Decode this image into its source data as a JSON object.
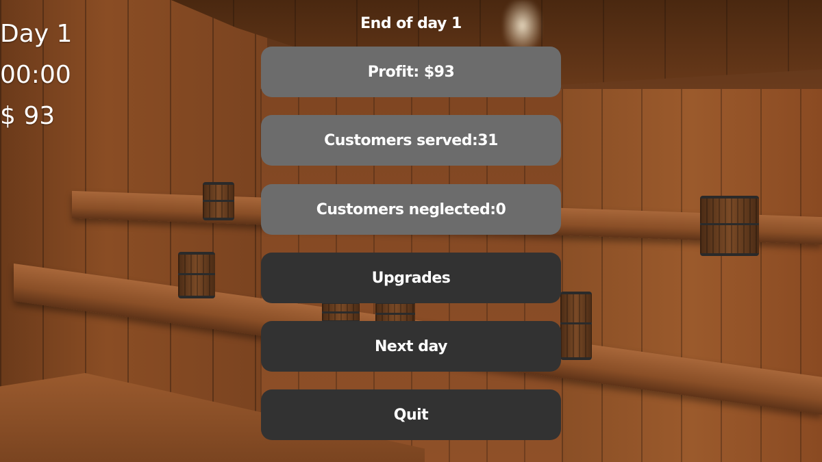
{
  "hud": {
    "day": "Day 1",
    "time": "00:00",
    "money": "$ 93"
  },
  "end_of_day": {
    "title": "End of day 1",
    "stats": {
      "profit": "Profit: $93",
      "customers_served": "Customers served:31",
      "customers_neglected": "Customers neglected:0"
    },
    "buttons": {
      "upgrades": "Upgrades",
      "next_day": "Next day",
      "quit": "Quit"
    }
  },
  "colors": {
    "stat_box": "#6c6c6c",
    "action_button": "#323232",
    "text": "#ffffff"
  }
}
